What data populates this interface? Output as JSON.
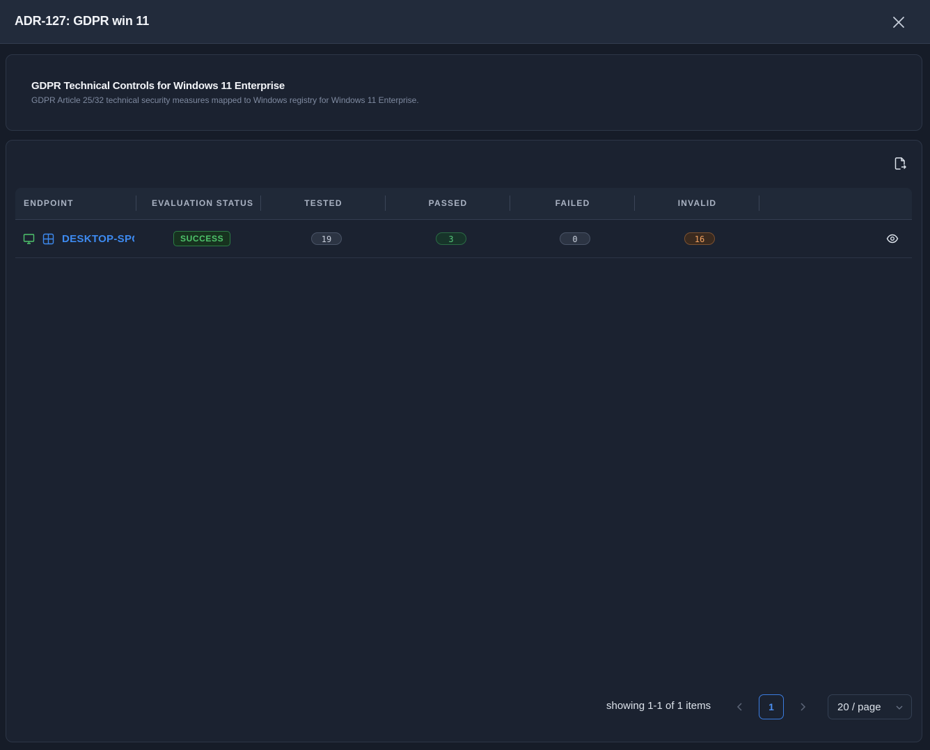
{
  "modal": {
    "title": "ADR-127: GDPR win 11"
  },
  "info": {
    "title": "GDPR Technical Controls for Windows 11 Enterprise",
    "description": "GDPR Article 25/32 technical security measures mapped to Windows registry for Windows 11 Enterprise."
  },
  "toolbar": {
    "export_icon": "file-export-icon"
  },
  "table": {
    "columns": [
      "ENDPOINT",
      "EVALUATION STATUS",
      "TESTED",
      "PASSED",
      "FAILED",
      "INVALID"
    ],
    "rows": [
      {
        "endpoint": "DESKTOP-SPQ",
        "status": "SUCCESS",
        "tested": "19",
        "passed": "3",
        "failed": "0",
        "invalid": "16"
      }
    ]
  },
  "pagination": {
    "summary": "showing 1-1 of 1 items",
    "current_page": "1",
    "page_size": "20 / page"
  },
  "colors": {
    "accent": "#3d8af0",
    "success": "#4fc46c",
    "warning": "#f0a060",
    "background": "#161c28"
  }
}
